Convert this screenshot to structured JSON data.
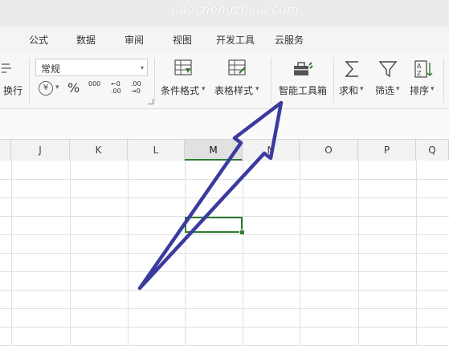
{
  "watermark": "jiaochengzhijia.com",
  "menu": {
    "items": [
      "公式",
      "数据",
      "审阅",
      "视图",
      "开发工具",
      "云服务"
    ]
  },
  "ribbon": {
    "wrap_label": "换行",
    "number_format": "常规",
    "currency_symbol": "¥",
    "percent_symbol": "%",
    "thousands_symbol": "000",
    "increase_decimal": "←0 .00",
    "decrease_decimal": ".00 →0",
    "cond_format_label": "条件格式",
    "table_style_label": "表格样式",
    "smart_toolbox_label": "智能工具箱",
    "sum_label": "求和",
    "filter_label": "筛选",
    "sort_label": "排序",
    "dropdown_glyph": "▾"
  },
  "sheet": {
    "columns": [
      "J",
      "K",
      "L",
      "M",
      "N",
      "O",
      "P",
      "Q"
    ],
    "active_column": "M"
  },
  "colors": {
    "accent_green": "#2e7d32",
    "arrow": "#3b3b9f"
  }
}
